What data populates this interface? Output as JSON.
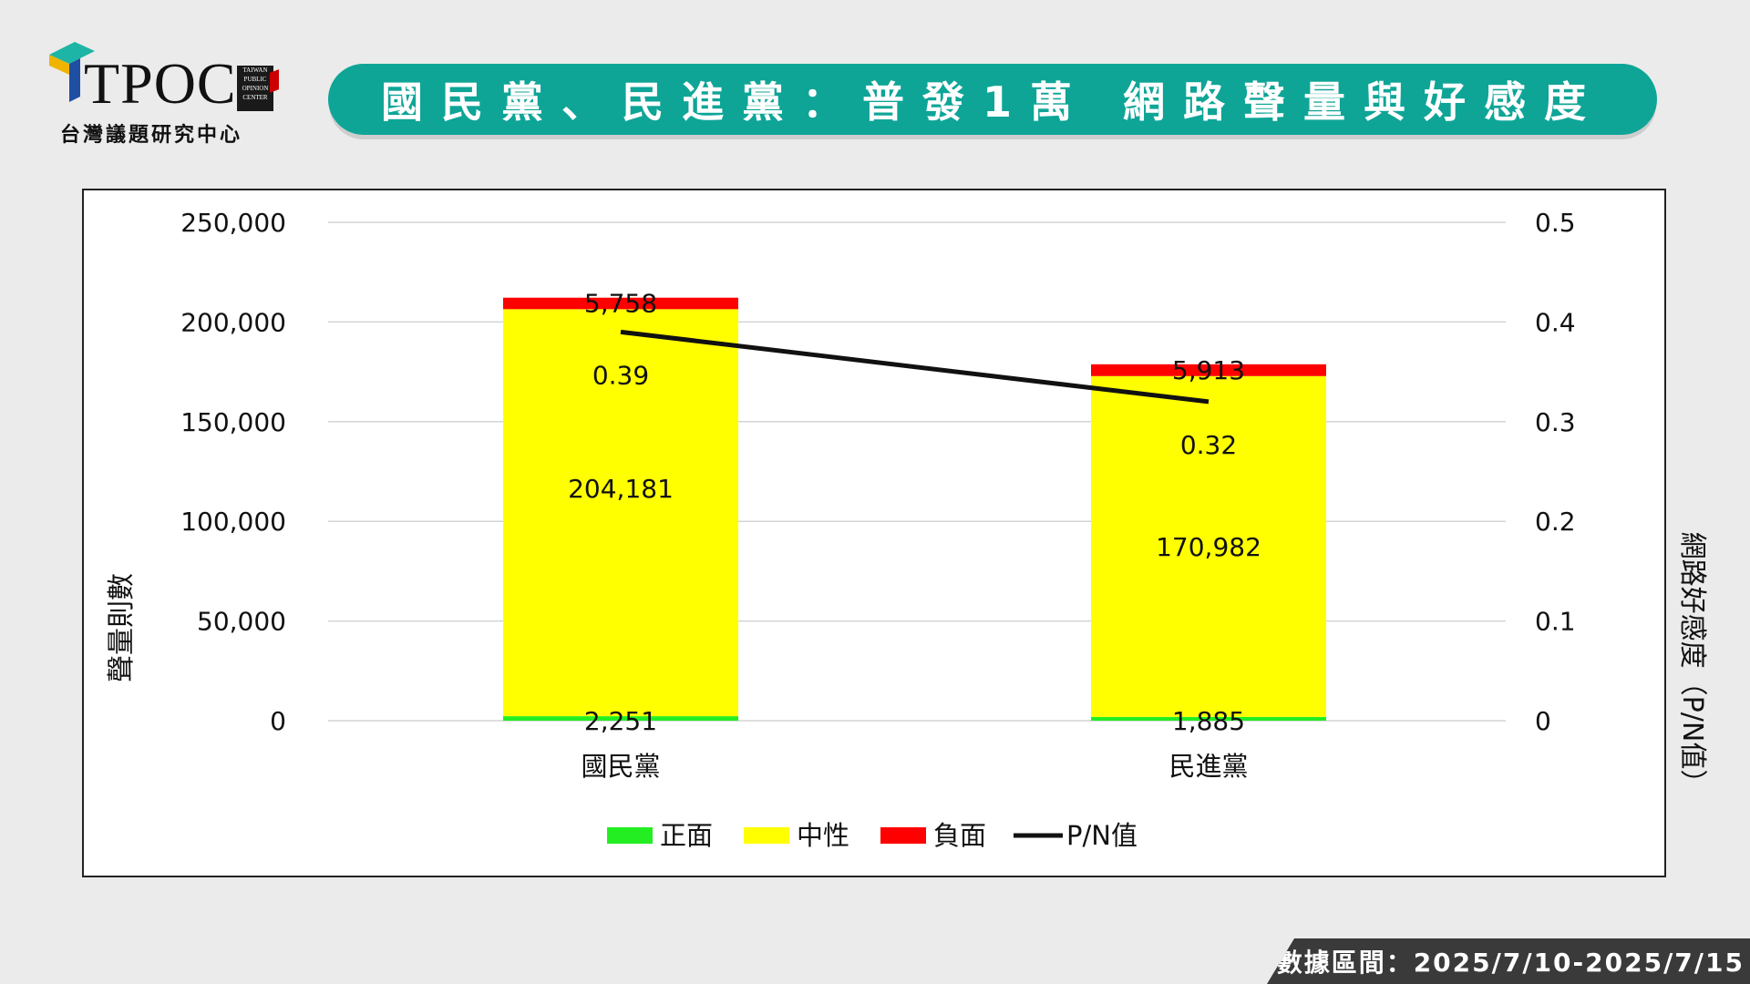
{
  "logo": {
    "wordmark": "TPOC",
    "badge_lines": [
      "TAIWAN",
      "PUBLIC",
      "OPINION",
      "CENTER"
    ],
    "subtitle": "台灣議題研究中心"
  },
  "banner": {
    "title": "國民黨、民進黨：普發1萬 網路聲量與好感度"
  },
  "colors": {
    "banner": "#0ea597",
    "positive": "#22ee22",
    "neutral": "#ffff00",
    "negative": "#ff0000",
    "pn_line": "#111111"
  },
  "chart_data": {
    "type": "bar",
    "stacked": true,
    "categories": [
      "國民黨",
      "民進黨"
    ],
    "series": [
      {
        "name": "正面",
        "values": [
          2251,
          1885
        ],
        "labels": [
          "2,251",
          "1,885"
        ]
      },
      {
        "name": "中性",
        "values": [
          204181,
          170982
        ],
        "labels": [
          "204,181",
          "170,982"
        ]
      },
      {
        "name": "負面",
        "values": [
          5758,
          5913
        ],
        "labels": [
          "5,758",
          "5,913"
        ]
      }
    ],
    "line_series": {
      "name": "P/N值",
      "values": [
        0.39,
        0.32
      ],
      "labels": [
        "0.39",
        "0.32"
      ],
      "axis": "right"
    },
    "ylabel": "聲量則數",
    "y2label": "網路好感度（P/N值）",
    "ylim": [
      0,
      250000
    ],
    "y2lim": [
      0,
      0.5
    ],
    "yticks": [
      "0",
      "50,000",
      "100,000",
      "150,000",
      "200,000",
      "250,000"
    ],
    "y2ticks": [
      "0",
      "0.1",
      "0.2",
      "0.3",
      "0.4",
      "0.5"
    ],
    "grid": true,
    "legend": [
      "正面",
      "中性",
      "負面",
      "P/N值"
    ],
    "legend_position": "bottom"
  },
  "footer": {
    "date_range": "數據區間：2025/7/10-2025/7/15"
  }
}
